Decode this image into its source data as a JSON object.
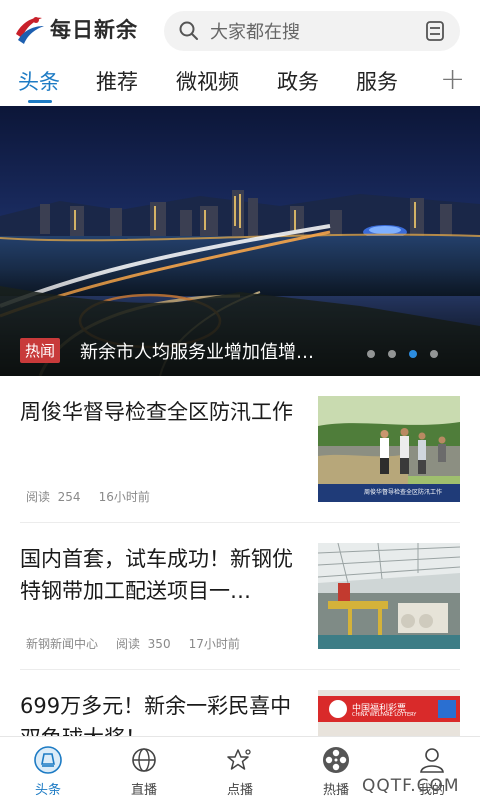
{
  "app": {
    "name": "每日新余"
  },
  "search": {
    "placeholder": "大家都在搜"
  },
  "tabs": [
    {
      "label": "头条",
      "active": true
    },
    {
      "label": "推荐"
    },
    {
      "label": "微视频"
    },
    {
      "label": "政务"
    },
    {
      "label": "服务"
    }
  ],
  "banner": {
    "tag": "热闻",
    "title": "新余市人均服务业增加值增…",
    "slide_count": 4,
    "active_slide": 3
  },
  "articles": [
    {
      "title": "周俊华督导检查全区防汛工作",
      "source": "",
      "reads_label": "阅读",
      "reads": "254",
      "time": "16小时前"
    },
    {
      "title": "国内首套，试车成功！新钢优特钢带加工配送项目一…",
      "source": "新钢新闻中心",
      "reads_label": "阅读",
      "reads": "350",
      "time": "17小时前"
    },
    {
      "title": "699万多元！新余一彩民喜中双色球大奖！",
      "source": "",
      "reads_label": "",
      "reads": "",
      "time": ""
    }
  ],
  "thumbs": {
    "t1_caption": "周俊华督导检查全区防汛工作",
    "t3_sign": "中国福利彩票",
    "t3_sign_en": "CHINA WELFARE LOTTERY"
  },
  "bottom_nav": [
    {
      "label": "头条",
      "active": true
    },
    {
      "label": "直播"
    },
    {
      "label": "点播"
    },
    {
      "label": "热播"
    },
    {
      "label": "我的"
    }
  ],
  "watermark": "QQTF.COM",
  "colors": {
    "accent": "#1d7bc4",
    "tag_red": "#c83a3a"
  }
}
